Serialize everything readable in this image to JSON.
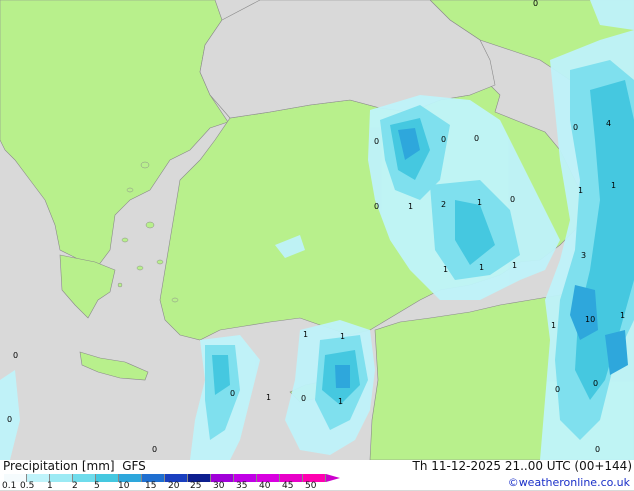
{
  "legend": {
    "title": "Precipitation [mm]  GFS",
    "scale_values": [
      "0.1",
      "0.5",
      "1",
      "2",
      "5",
      "10",
      "15",
      "20",
      "25",
      "30",
      "35",
      "40",
      "45",
      "50"
    ],
    "scale_colors": [
      "#f5fbfd",
      "#bff3fa",
      "#9ceaf4",
      "#6fdcec",
      "#45c8e0",
      "#2ea7dc",
      "#1f6fd0",
      "#1a3fbf",
      "#0d1e8e",
      "#a000d8",
      "#c000e6",
      "#d800e0",
      "#e800c8",
      "#ff00b0"
    ]
  },
  "run_info": "Th 11-12-2025 21..00 UTC (00+144)",
  "credit": "©weatheronline.co.uk",
  "map_labels": [
    "0",
    "0",
    "0",
    "0",
    "4",
    "0",
    "0",
    "1",
    "2",
    "1",
    "0",
    "1",
    "1",
    "1",
    "1",
    "3",
    "10",
    "1",
    "1",
    "1",
    "1",
    "0",
    "1",
    "0",
    "1",
    "0",
    "0",
    "0",
    "0",
    "1",
    "0",
    "0"
  ],
  "colors": {
    "land": "#b8f08c",
    "sea": "#d9d9d9",
    "precip_light": "#bff3fa",
    "precip_mid": "#7fe0ee",
    "precip_heavy": "#45c8e0",
    "precip_core": "#2ea7dc"
  }
}
